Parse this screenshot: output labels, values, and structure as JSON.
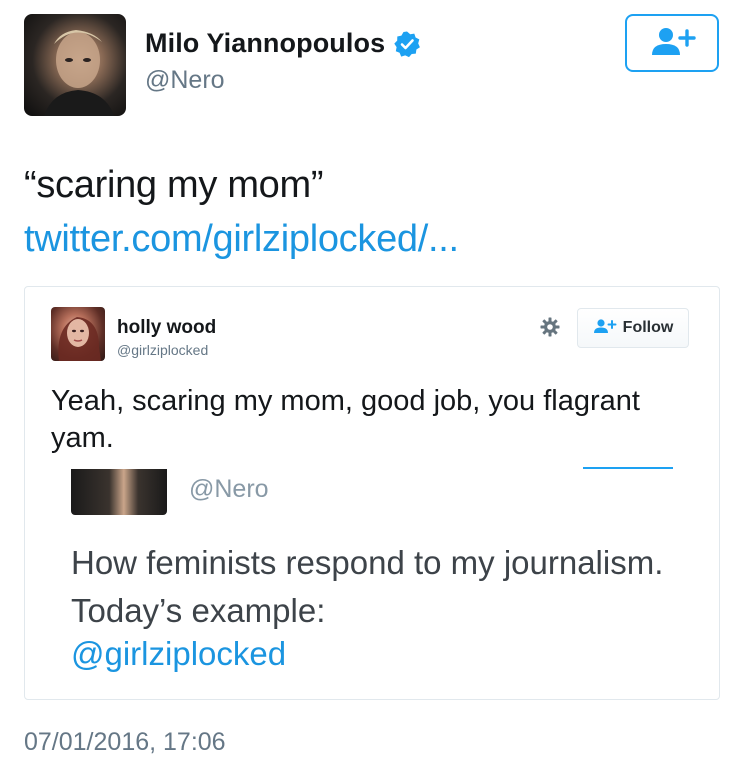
{
  "tweet": {
    "author_name": "Milo Yiannopoulos",
    "author_handle": "@Nero",
    "text": "“scaring my mom”",
    "link": "twitter.com/girlziplocked/...",
    "timestamp": "07/01/2016, 17:06",
    "verified_icon": "verified-badge-icon",
    "follow_icon": "add-user-icon"
  },
  "quoted": {
    "author_name": "holly wood",
    "author_handle": "@girlziplocked",
    "follow_label": "Follow",
    "text": "Yeah, scaring my mom, good job, you flagrant yam.",
    "settings_icon": "gear-icon"
  },
  "nested": {
    "author_handle": "@Nero",
    "text": "How feminists respond to my journalism. Today’s example:",
    "mention": "@girlziplocked"
  },
  "colors": {
    "accent": "#1da1f2",
    "link": "#1b95e0",
    "secondary_text": "#657786"
  }
}
